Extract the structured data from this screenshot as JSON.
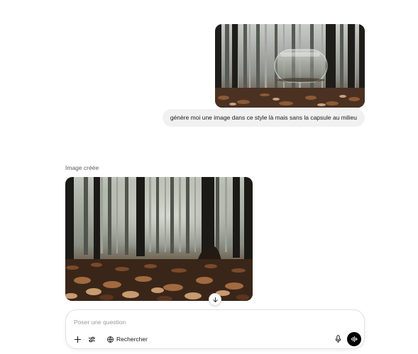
{
  "conversation": {
    "user_message": {
      "image_icon": "forest-image-with-glass-capsule",
      "text": "génère moi une image dans ce style là mais sans la capsule au milieu"
    },
    "assistant_message": {
      "label": "Image créée",
      "image_icon": "forest-floor-image"
    }
  },
  "scroll_down_icon": "arrow-down-icon",
  "composer": {
    "placeholder": "Poser une question",
    "tools": {
      "plus_icon": "plus-icon",
      "settings_icon": "sliders-icon",
      "search_icon": "globe-search-icon",
      "search_label": "Rechercher"
    },
    "mic_icon": "microphone-icon",
    "voice_icon": "voice-waveform-icon"
  },
  "colors": {
    "bubble_bg": "#f1f1f1",
    "voice_button": "#000000",
    "border": "#e2e2e2"
  }
}
